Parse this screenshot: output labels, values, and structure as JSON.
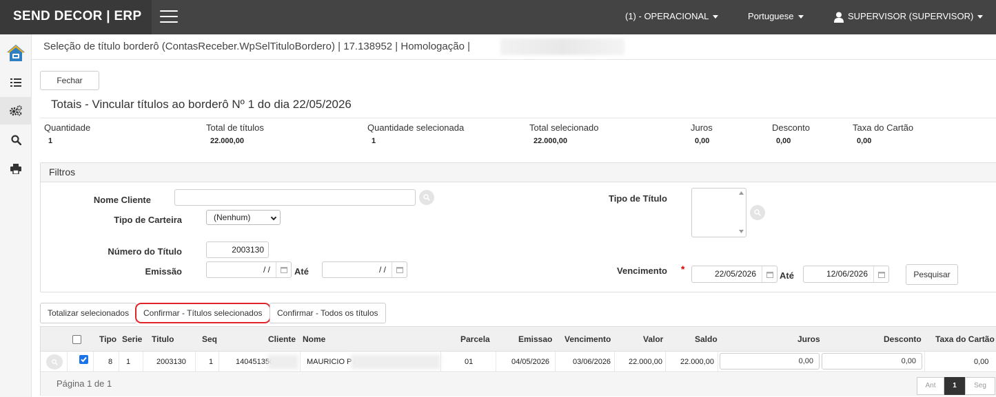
{
  "header": {
    "brand": "SEND DECOR | ERP",
    "company": "(1) - OPERACIONAL",
    "language": "Portuguese",
    "user": "SUPERVISOR (SUPERVISOR)"
  },
  "sidebar": {
    "items": [
      {
        "icon": "home-icon"
      },
      {
        "icon": "list-icon"
      },
      {
        "icon": "gears-icon"
      },
      {
        "icon": "search-icon"
      },
      {
        "icon": "print-icon"
      }
    ]
  },
  "breadcrumb": "Seleção de título borderô (ContasReceber.WpSelTituloBordero) | 17.138952 | Homologação |",
  "close_button": "Fechar",
  "totals_title": "Totais - Vincular títulos ao borderô Nº 1 do dia 22/05/2026",
  "totals": [
    {
      "label": "Quantidade",
      "value": "1"
    },
    {
      "label": "Total de títulos",
      "value": "22.000,00"
    },
    {
      "label": "Quantidade selecionada",
      "value": "1"
    },
    {
      "label": "Total selecionado",
      "value": "22.000,00"
    },
    {
      "label": "Juros",
      "value": "0,00"
    },
    {
      "label": "Desconto",
      "value": "0,00"
    },
    {
      "label": "Taxa do Cartão",
      "value": "0,00"
    }
  ],
  "filters": {
    "title": "Filtros",
    "nome_cliente_label": "Nome Cliente",
    "nome_cliente_value": "",
    "tipo_carteira_label": "Tipo de Carteira",
    "tipo_carteira_value": "(Nenhum)",
    "numero_titulo_label": "Número do Título",
    "numero_titulo_value": "2003130",
    "emissao_label": "Emissão",
    "emissao_from": " / /",
    "ate_label": "Até",
    "emissao_to": " / /",
    "tipo_titulo_label": "Tipo de Título",
    "vencimento_label": "Vencimento",
    "required_mark": "*",
    "vencimento_from": "22/05/2026",
    "vencimento_to": "12/06/2026",
    "search_button": "Pesquisar"
  },
  "actions": {
    "total_selected": "Totalizar selecionados",
    "confirm_selected": "Confirmar - Títulos selecionados",
    "confirm_all": "Confirmar - Todos os títulos"
  },
  "grid": {
    "columns": [
      "Tipo",
      "Serie",
      "Titulo",
      "Seq",
      "Cliente",
      "Nome",
      "Parcela",
      "Emissao",
      "Vencimento",
      "Valor",
      "Saldo",
      "Juros",
      "Desconto",
      "Taxa do Cartão"
    ],
    "rows": [
      {
        "selected": true,
        "tipo": "8",
        "serie": "1",
        "titulo": "2003130",
        "seq": "1",
        "cliente": "140451350",
        "nome": "MAURICIO P A",
        "parcela": "01",
        "emissao": "04/05/2026",
        "vencimento": "03/06/2026",
        "valor": "22.000,00",
        "saldo": "22.000,00",
        "juros": "0,00",
        "desconto": "0,00",
        "taxa": "0,00"
      }
    ],
    "pagination": {
      "summary": "Página 1 de 1",
      "prev": "Ant",
      "current": "1",
      "next": "Seg"
    }
  },
  "colors": {
    "topbar": "#444444",
    "brand_bg": "#393939",
    "highlight": "#e0252a",
    "checkbox": "#1a73e8",
    "home_icon": "#2f7fc1",
    "home_icon_accent": "#f2b01e"
  }
}
